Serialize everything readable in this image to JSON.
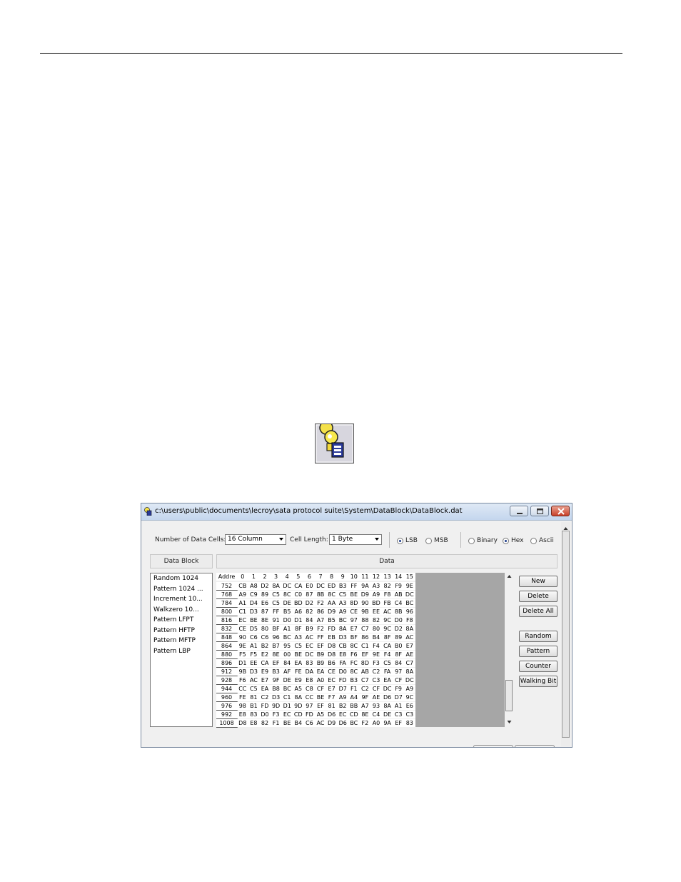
{
  "window": {
    "title": "c:\\users\\public\\documents\\lecroy\\sata protocol suite\\System\\DataBlock\\DataBlock.dat"
  },
  "toolbar": {
    "num_cells_label": "Number of Data Cells:",
    "num_cells_value": "16 Column",
    "cell_length_label": "Cell Length:",
    "cell_length_value": "1  Byte",
    "lsb": "LSB",
    "msb": "MSB",
    "binary": "Binary",
    "hex": "Hex",
    "ascii": "Ascii"
  },
  "panels": {
    "datablock_header": "Data Block",
    "data_header": "Data"
  },
  "datablocks": [
    "Random 1024",
    "Pattern 1024 ...",
    "Increment 10...",
    "Walkzero 10...",
    "Pattern LFPT",
    "Pattern HFTP",
    "Pattern MFTP",
    "Pattern LBP"
  ],
  "grid": {
    "addr_header": "Addre",
    "columns": [
      "0",
      "1",
      "2",
      "3",
      "4",
      "5",
      "6",
      "7",
      "8",
      "9",
      "10",
      "11",
      "12",
      "13",
      "14",
      "15"
    ],
    "rows": [
      {
        "addr": "752",
        "cells": [
          "CB",
          "A8",
          "D2",
          "8A",
          "DC",
          "CA",
          "E0",
          "DC",
          "ED",
          "B3",
          "FF",
          "9A",
          "A3",
          "82",
          "F9",
          "9E"
        ]
      },
      {
        "addr": "768",
        "cells": [
          "A9",
          "C9",
          "89",
          "C5",
          "8C",
          "C0",
          "87",
          "8B",
          "8C",
          "C5",
          "BE",
          "D9",
          "A9",
          "F8",
          "AB",
          "DC"
        ]
      },
      {
        "addr": "784",
        "cells": [
          "A1",
          "D4",
          "E6",
          "C5",
          "DE",
          "BD",
          "D2",
          "F2",
          "AA",
          "A3",
          "8D",
          "90",
          "BD",
          "FB",
          "C4",
          "BC"
        ]
      },
      {
        "addr": "800",
        "cells": [
          "C1",
          "D3",
          "87",
          "FF",
          "B5",
          "A6",
          "82",
          "86",
          "D9",
          "A9",
          "CE",
          "9B",
          "EE",
          "AC",
          "8B",
          "96"
        ]
      },
      {
        "addr": "816",
        "cells": [
          "EC",
          "BE",
          "8E",
          "91",
          "D0",
          "D1",
          "84",
          "A7",
          "B5",
          "BC",
          "97",
          "88",
          "82",
          "9C",
          "D0",
          "F8"
        ]
      },
      {
        "addr": "832",
        "cells": [
          "CE",
          "D5",
          "80",
          "BF",
          "A1",
          "8F",
          "B9",
          "F2",
          "FD",
          "8A",
          "E7",
          "C7",
          "80",
          "9C",
          "D2",
          "8A"
        ]
      },
      {
        "addr": "848",
        "cells": [
          "90",
          "C6",
          "C6",
          "96",
          "BC",
          "A3",
          "AC",
          "FF",
          "EB",
          "D3",
          "BF",
          "86",
          "B4",
          "8F",
          "89",
          "AC"
        ]
      },
      {
        "addr": "864",
        "cells": [
          "9E",
          "A1",
          "B2",
          "B7",
          "95",
          "C5",
          "EC",
          "EF",
          "D8",
          "CB",
          "8C",
          "C1",
          "F4",
          "CA",
          "B0",
          "E7"
        ]
      },
      {
        "addr": "880",
        "cells": [
          "F5",
          "F5",
          "E2",
          "8E",
          "00",
          "BE",
          "DC",
          "B9",
          "D8",
          "E8",
          "F6",
          "EF",
          "9E",
          "F4",
          "8F",
          "AE"
        ]
      },
      {
        "addr": "896",
        "cells": [
          "D1",
          "EE",
          "CA",
          "EF",
          "84",
          "EA",
          "83",
          "B9",
          "B6",
          "FA",
          "FC",
          "8D",
          "F3",
          "C5",
          "84",
          "C7"
        ]
      },
      {
        "addr": "912",
        "cells": [
          "9B",
          "D3",
          "E9",
          "B3",
          "AF",
          "FE",
          "DA",
          "EA",
          "CE",
          "D0",
          "8C",
          "AB",
          "C2",
          "FA",
          "97",
          "8A"
        ]
      },
      {
        "addr": "928",
        "cells": [
          "F6",
          "AC",
          "E7",
          "9F",
          "DE",
          "E9",
          "E8",
          "A0",
          "EC",
          "FD",
          "B3",
          "C7",
          "C3",
          "EA",
          "CF",
          "DC"
        ]
      },
      {
        "addr": "944",
        "cells": [
          "CC",
          "C5",
          "EA",
          "B8",
          "BC",
          "A5",
          "C8",
          "CF",
          "E7",
          "D7",
          "F1",
          "C2",
          "CF",
          "DC",
          "F9",
          "A9"
        ]
      },
      {
        "addr": "960",
        "cells": [
          "FE",
          "81",
          "C2",
          "D3",
          "C1",
          "8A",
          "CC",
          "BE",
          "F7",
          "A9",
          "A4",
          "9F",
          "AE",
          "D6",
          "D7",
          "9C"
        ]
      },
      {
        "addr": "976",
        "cells": [
          "98",
          "B1",
          "FD",
          "9D",
          "D1",
          "9D",
          "97",
          "EF",
          "81",
          "B2",
          "BB",
          "A7",
          "93",
          "8A",
          "A1",
          "E6"
        ]
      },
      {
        "addr": "992",
        "cells": [
          "E8",
          "83",
          "D0",
          "F3",
          "EC",
          "CD",
          "FD",
          "A5",
          "D6",
          "EC",
          "CD",
          "8E",
          "C4",
          "DE",
          "C3",
          "C3"
        ]
      },
      {
        "addr": "1008",
        "cells": [
          "D8",
          "E8",
          "82",
          "F1",
          "BE",
          "B4",
          "C6",
          "AC",
          "D9",
          "D6",
          "BC",
          "F2",
          "A0",
          "9A",
          "EF",
          "83"
        ]
      }
    ]
  },
  "buttons": {
    "new": "New",
    "delete": "Delete",
    "delete_all": "Delete All",
    "random": "Random",
    "pattern": "Pattern",
    "counter": "Counter",
    "walking_bit": "Walking Bit"
  },
  "colors": {
    "gray_area": "#a6a6a6",
    "title_gradient_top": "#dfe9f5",
    "close_button": "#c8402a"
  }
}
